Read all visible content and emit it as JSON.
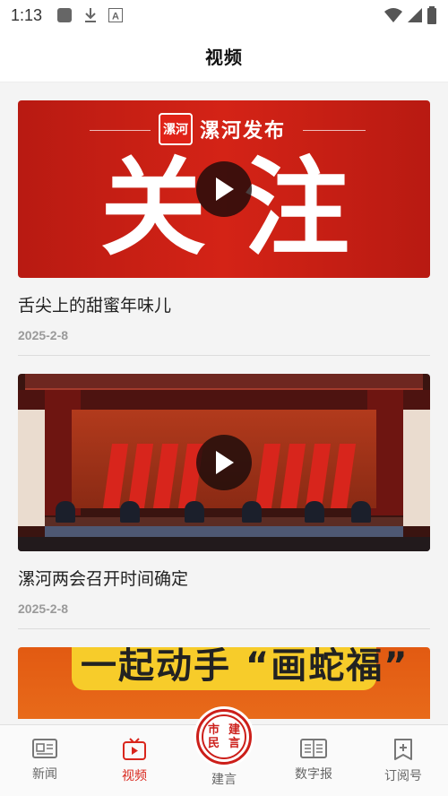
{
  "status_bar": {
    "time": "1:13",
    "left_icons": [
      "app-square-icon",
      "download-icon",
      "a-badge-icon"
    ],
    "right_icons": [
      "wifi-icon",
      "signal-icon",
      "battery-icon"
    ]
  },
  "header": {
    "title": "视频"
  },
  "videos": [
    {
      "title": "舌尖上的甜蜜年味儿",
      "date": "2025-2-8",
      "thumb": {
        "logo_text": "漯河",
        "brand_text": "漯河发布",
        "big_left": "关",
        "big_right": "注"
      }
    },
    {
      "title": "漯河两会召开时间确定",
      "date": "2025-2-8"
    }
  ],
  "partial_video": {
    "headline": "一起动手 “画蛇福”"
  },
  "bottom_nav": {
    "items": [
      {
        "label": "新闻",
        "icon": "news-icon"
      },
      {
        "label": "视频",
        "icon": "video-icon"
      },
      {
        "label": "建言",
        "icon": "suggestion-badge-icon",
        "badge_text": "市民建言"
      },
      {
        "label": "数字报",
        "icon": "newspaper-icon"
      },
      {
        "label": "订阅号",
        "icon": "subscribe-icon"
      }
    ],
    "active": "视频"
  },
  "colors": {
    "accent": "#d9261c",
    "banner_red": "#c8201a"
  }
}
